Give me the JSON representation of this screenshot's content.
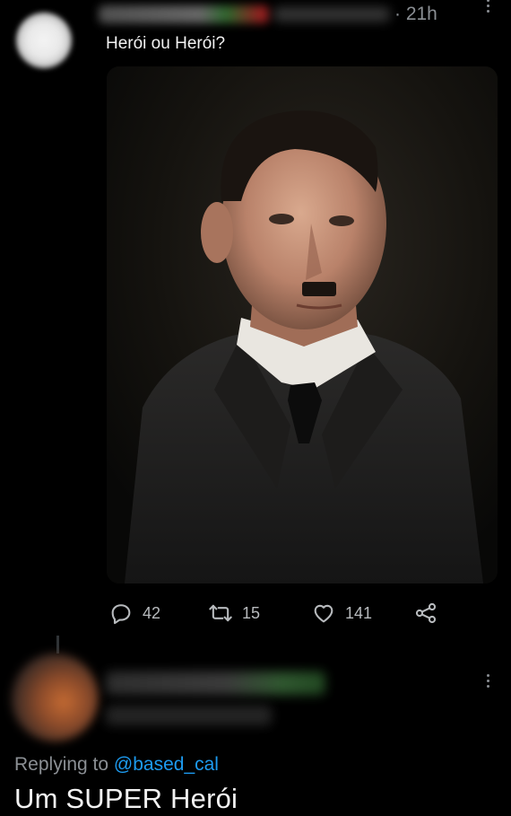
{
  "tweet": {
    "time": "· 21h",
    "text": "Herói ou Herói?",
    "photo_alt": "photo",
    "stats": {
      "replies": "42",
      "retweets": "15",
      "likes": "141"
    }
  },
  "reply": {
    "replying_prefix": "Replying to",
    "replying_handle": "@based_cal",
    "text": "Um SUPER Herói"
  },
  "icons": {
    "more": "more-icon",
    "reply": "reply-icon",
    "retweet": "retweet-icon",
    "like": "heart-icon",
    "share": "share-icon"
  },
  "colors": {
    "background": "#000000",
    "text": "#e7e9ea",
    "muted": "#8b8f94",
    "link": "#1d9bf0"
  }
}
